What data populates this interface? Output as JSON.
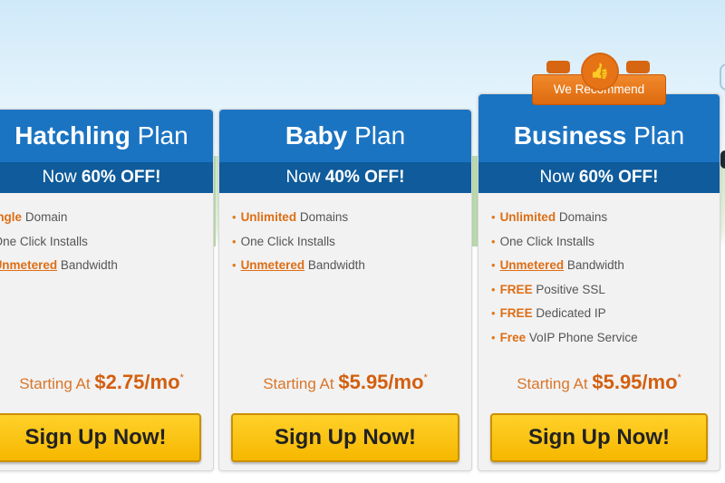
{
  "plans": [
    {
      "name_bold": "Hatchling",
      "name_suffix": "Plan",
      "discount_prefix": "Now",
      "discount_value": "60% OFF!",
      "features": [
        {
          "parts": [
            {
              "t": "ingle",
              "s": "hl"
            },
            {
              "t": " Domain",
              "s": ""
            }
          ]
        },
        {
          "parts": [
            {
              "t": "One Click Installs",
              "s": ""
            }
          ]
        },
        {
          "parts": [
            {
              "t": "Unmetered",
              "s": "ul"
            },
            {
              "t": " Bandwidth",
              "s": ""
            }
          ]
        }
      ],
      "price_prefix": "Starting At",
      "price_amount": "$2.75/mo",
      "price_mark": "*",
      "button_label": "Sign Up Now!"
    },
    {
      "name_bold": "Baby",
      "name_suffix": "Plan",
      "discount_prefix": "Now",
      "discount_value": "40% OFF!",
      "features": [
        {
          "parts": [
            {
              "t": "Unlimited",
              "s": "hl"
            },
            {
              "t": " Domains",
              "s": ""
            }
          ]
        },
        {
          "parts": [
            {
              "t": "One Click Installs",
              "s": ""
            }
          ]
        },
        {
          "parts": [
            {
              "t": "Unmetered",
              "s": "ul"
            },
            {
              "t": " Bandwidth",
              "s": ""
            }
          ]
        }
      ],
      "price_prefix": "Starting At",
      "price_amount": "$5.95/mo",
      "price_mark": "*",
      "button_label": "Sign Up Now!"
    },
    {
      "name_bold": "Business",
      "name_suffix": "Plan",
      "discount_prefix": "Now",
      "discount_value": "60% OFF!",
      "features": [
        {
          "parts": [
            {
              "t": "Unlimited",
              "s": "hl"
            },
            {
              "t": " Domains",
              "s": ""
            }
          ]
        },
        {
          "parts": [
            {
              "t": "One Click Installs",
              "s": ""
            }
          ]
        },
        {
          "parts": [
            {
              "t": "Unmetered",
              "s": "ul"
            },
            {
              "t": " Bandwidth",
              "s": ""
            }
          ]
        },
        {
          "parts": [
            {
              "t": "FREE",
              "s": "hl"
            },
            {
              "t": " Positive SSL",
              "s": ""
            }
          ]
        },
        {
          "parts": [
            {
              "t": "FREE",
              "s": "hl"
            },
            {
              "t": " Dedicated IP",
              "s": ""
            }
          ]
        },
        {
          "parts": [
            {
              "t": "Free",
              "s": "hl"
            },
            {
              "t": " VoIP Phone Service",
              "s": ""
            }
          ]
        }
      ],
      "price_prefix": "Starting At",
      "price_amount": "$5.95/mo",
      "price_mark": "*",
      "button_label": "Sign Up Now!"
    }
  ],
  "recommend": {
    "label": "We Recommend",
    "icon": "thumbs-up-icon"
  },
  "colors": {
    "header_blue": "#1b74c2",
    "discount_blue": "#0f5b9b",
    "accent_orange": "#dd6e15",
    "button_yellow": "#ffd12a"
  }
}
